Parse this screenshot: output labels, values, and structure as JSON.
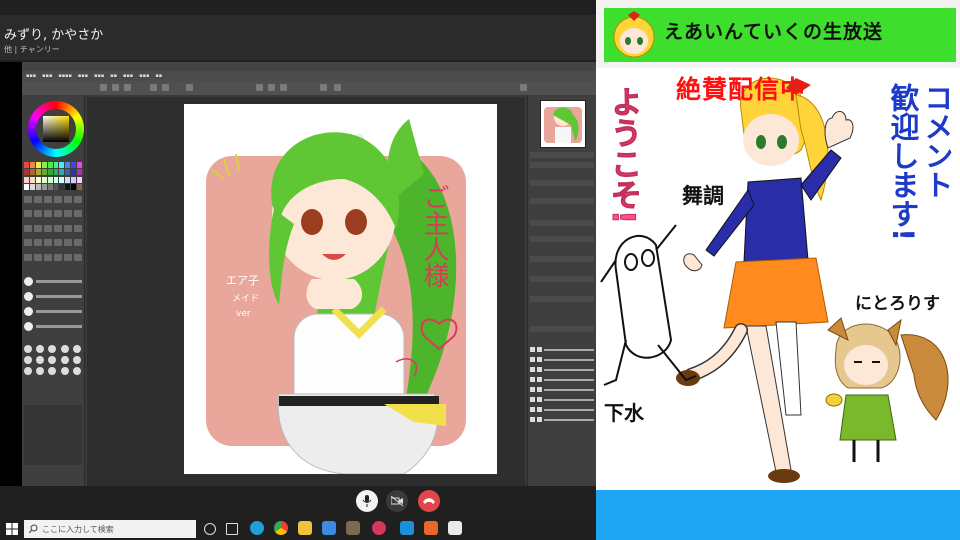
{
  "call": {
    "title": "みずり, かやさか",
    "subtitle": "他 | チャンリー",
    "controls": {
      "mic_icon": "microphone-icon",
      "camera_icon": "camera-off-icon",
      "hangup_icon": "hangup-icon"
    }
  },
  "taskbar": {
    "search_placeholder": "ここに入力して検索",
    "icons": [
      "task-view-icon",
      "snap-icon",
      "edge-icon",
      "chrome-icon",
      "explorer-icon",
      "store-icon",
      "app-icon",
      "mail-icon",
      "app-icon-2",
      "skype-icon",
      "paint-icon",
      "settings-icon"
    ]
  },
  "overlay": {
    "banner_title": "えあいんていくの生放送",
    "live_label": "絶賛配信中",
    "welcome": "ようこそ!",
    "comment_line1": "コメント",
    "comment_line2": "歓迎します!",
    "name_maicho": "舞調",
    "name_nitoririsu": "にとろりす",
    "name_gesui": "下水"
  },
  "colors": {
    "banner_green": "#3ddf2c",
    "live_red": "#ff1111",
    "welcome_pink": "#ff4f88",
    "comment_blue": "#1e3ac8",
    "bottom_blue": "#1ea6f5",
    "hangup_red": "#e2464a"
  }
}
